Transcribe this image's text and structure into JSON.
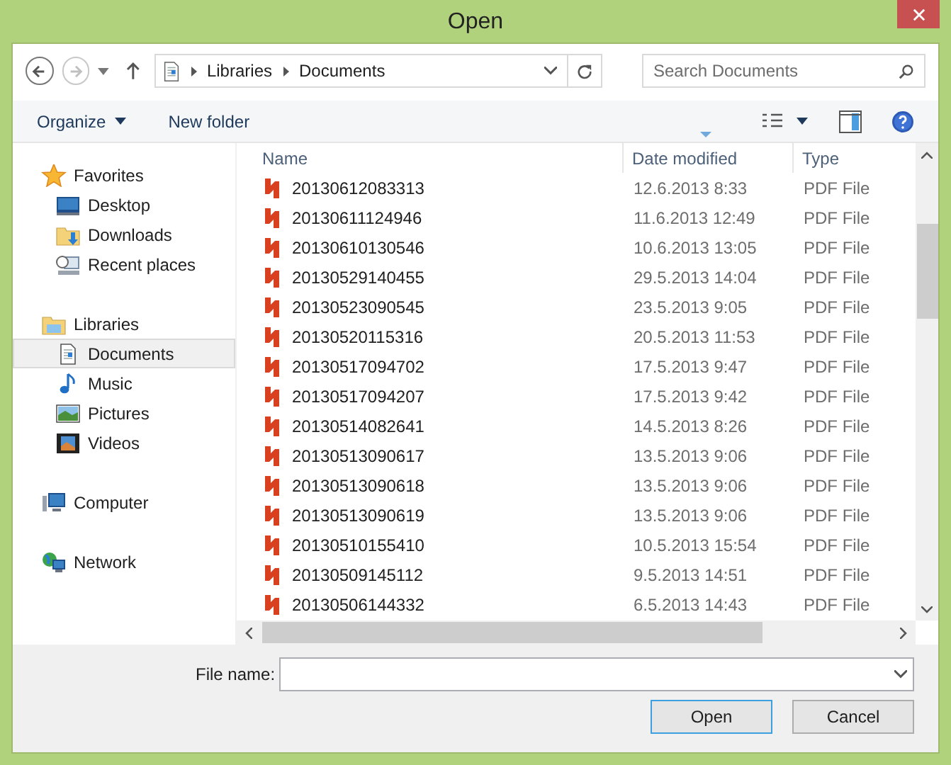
{
  "window": {
    "title": "Open"
  },
  "address": {
    "path": [
      "Libraries",
      "Documents"
    ]
  },
  "search": {
    "placeholder": "Search Documents"
  },
  "toolbar": {
    "organize": "Organize",
    "new_folder": "New folder"
  },
  "sidebar": {
    "groups": [
      {
        "label": "Favorites",
        "kind": "favorites",
        "selected": false,
        "children": [
          {
            "label": "Desktop",
            "kind": "desktop",
            "selected": false
          },
          {
            "label": "Downloads",
            "kind": "downloads",
            "selected": false
          },
          {
            "label": "Recent places",
            "kind": "recent",
            "selected": false
          }
        ]
      },
      {
        "label": "Libraries",
        "kind": "libraries",
        "selected": false,
        "children": [
          {
            "label": "Documents",
            "kind": "documents",
            "selected": true
          },
          {
            "label": "Music",
            "kind": "music",
            "selected": false
          },
          {
            "label": "Pictures",
            "kind": "pictures",
            "selected": false
          },
          {
            "label": "Videos",
            "kind": "videos",
            "selected": false
          }
        ]
      },
      {
        "label": "Computer",
        "kind": "computer",
        "selected": false
      },
      {
        "label": "Network",
        "kind": "network",
        "selected": false
      }
    ]
  },
  "table": {
    "columns": [
      "Name",
      "Date modified",
      "Type"
    ],
    "rows": [
      {
        "name": "20130612083313",
        "date": "12.6.2013 8:33",
        "type": "PDF File"
      },
      {
        "name": "20130611124946",
        "date": "11.6.2013 12:49",
        "type": "PDF File"
      },
      {
        "name": "20130610130546",
        "date": "10.6.2013 13:05",
        "type": "PDF File"
      },
      {
        "name": "20130529140455",
        "date": "29.5.2013 14:04",
        "type": "PDF File"
      },
      {
        "name": "20130523090545",
        "date": "23.5.2013 9:05",
        "type": "PDF File"
      },
      {
        "name": "20130520115316",
        "date": "20.5.2013 11:53",
        "type": "PDF File"
      },
      {
        "name": "20130517094702",
        "date": "17.5.2013 9:47",
        "type": "PDF File"
      },
      {
        "name": "20130517094207",
        "date": "17.5.2013 9:42",
        "type": "PDF File"
      },
      {
        "name": "20130514082641",
        "date": "14.5.2013 8:26",
        "type": "PDF File"
      },
      {
        "name": "20130513090617",
        "date": "13.5.2013 9:06",
        "type": "PDF File"
      },
      {
        "name": "20130513090618",
        "date": "13.5.2013 9:06",
        "type": "PDF File"
      },
      {
        "name": "20130513090619",
        "date": "13.5.2013 9:06",
        "type": "PDF File"
      },
      {
        "name": "20130510155410",
        "date": "10.5.2013 15:54",
        "type": "PDF File"
      },
      {
        "name": "20130509145112",
        "date": "9.5.2013 14:51",
        "type": "PDF File"
      },
      {
        "name": "20130506144332",
        "date": "6.5.2013 14:43",
        "type": "PDF File"
      }
    ]
  },
  "file_name": {
    "label": "File name:"
  },
  "buttons": [
    {
      "label": "Open",
      "kind": "default"
    },
    {
      "label": "Cancel",
      "kind": "normal"
    }
  ]
}
